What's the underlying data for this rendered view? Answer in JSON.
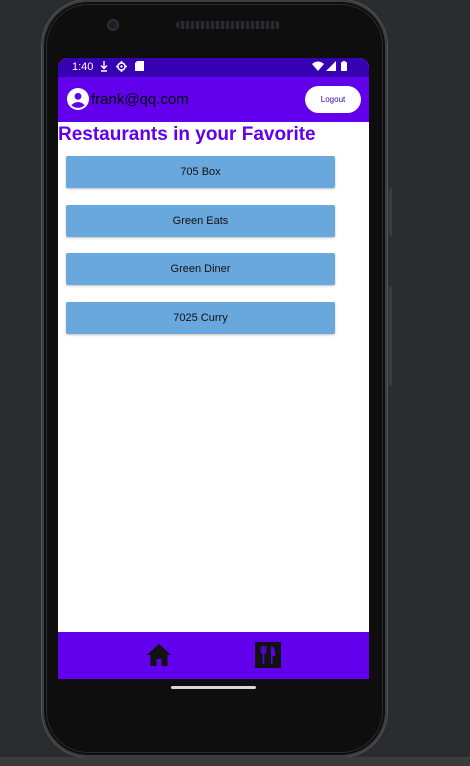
{
  "status_bar": {
    "time": "1:40",
    "left_icons": [
      "download-icon",
      "settings-icon",
      "sd-card-icon"
    ],
    "right_icons": [
      "wifi-icon",
      "signal-icon",
      "battery-icon"
    ]
  },
  "app_bar": {
    "user_email": "frank@qq.com",
    "logout_label": "Logout"
  },
  "main": {
    "title": "Restaurants in your Favorite",
    "restaurants": [
      "705 Box",
      "Green Eats",
      "Green Diner",
      "7025 Curry"
    ]
  },
  "bottom_nav": {
    "items": [
      "home-icon",
      "restaurant-icon"
    ]
  },
  "colors": {
    "primary": "#6200ee",
    "primary_dark": "#3700b3",
    "button": "#69a8dc"
  }
}
